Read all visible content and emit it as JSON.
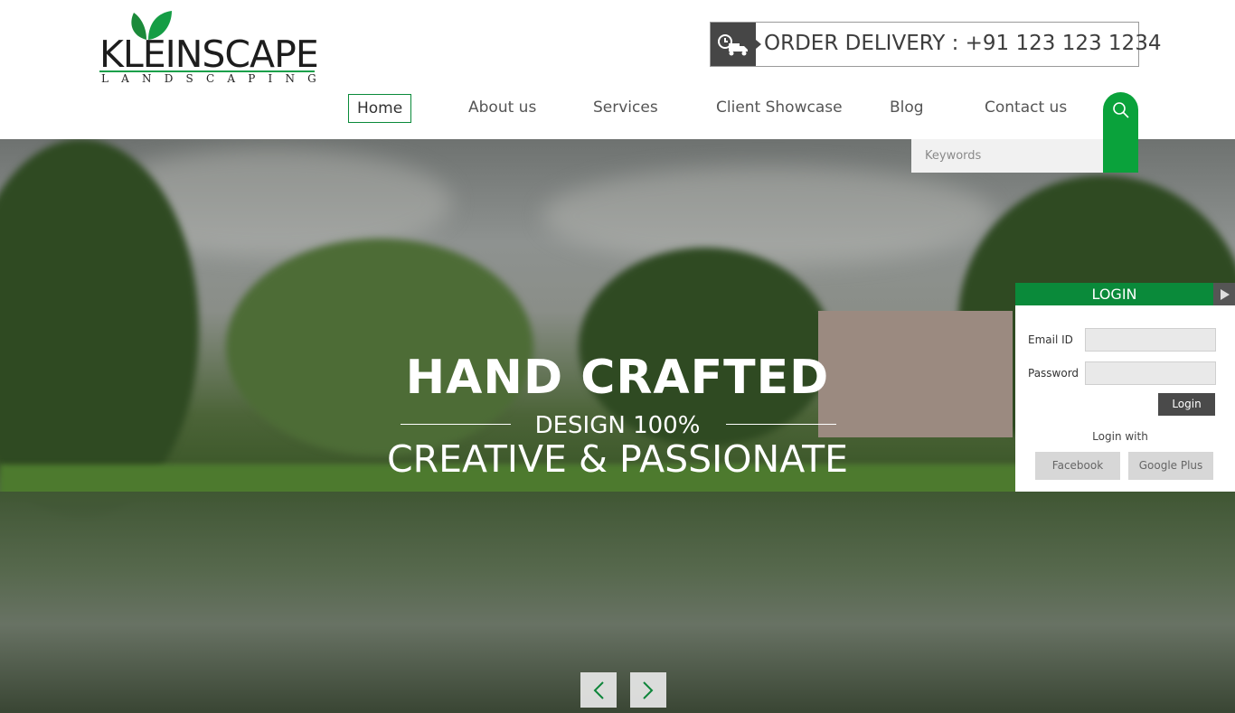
{
  "brand": {
    "name": "KLEINSCAPE",
    "tagline": "LANDSCAPING",
    "accent_color": "#0a8a3a"
  },
  "order": {
    "icon": "delivery-truck-icon",
    "text": "ORDER DELIVERY : +91 123 123 1234"
  },
  "nav": {
    "items": [
      {
        "label": "Home",
        "active": true
      },
      {
        "label": "About us"
      },
      {
        "label": "Services"
      },
      {
        "label": "Client Showcase"
      },
      {
        "label": "Blog"
      },
      {
        "label": "Contact us"
      }
    ]
  },
  "search": {
    "icon": "search-icon",
    "placeholder": "Keywords"
  },
  "hero": {
    "title": "HAND CRAFTED",
    "mid": "DESIGN 100%",
    "subtitle": "CREATIVE & PASSIONATE",
    "prev_icon": "chevron-left-icon",
    "next_icon": "chevron-right-icon"
  },
  "login": {
    "heading": "LOGIN",
    "email_label": "Email ID",
    "password_label": "Password",
    "submit_label": "Login",
    "login_with": "Login with",
    "facebook_label": "Facebook",
    "google_label": "Google Plus"
  }
}
